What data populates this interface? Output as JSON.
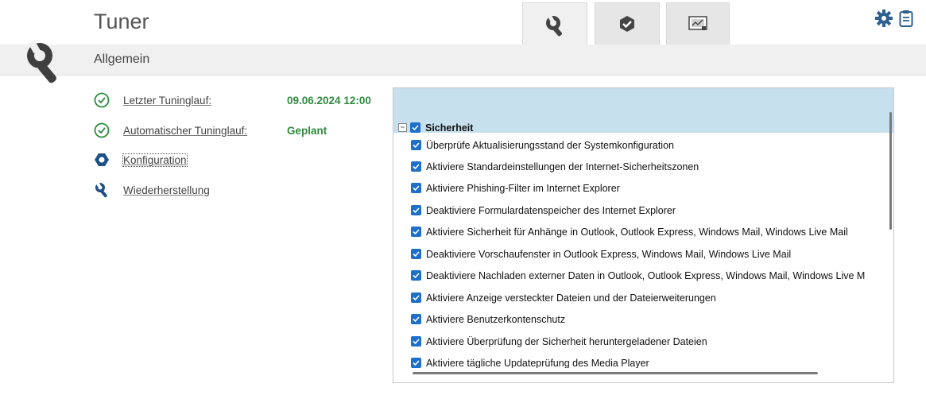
{
  "header": {
    "title": "Tuner",
    "tabs": [
      {
        "icon": "wrench-icon",
        "active": true
      },
      {
        "icon": "shield-check-icon",
        "active": false
      },
      {
        "icon": "screen-graph-icon",
        "active": false
      }
    ],
    "actions": [
      {
        "icon": "gear-icon"
      },
      {
        "icon": "clipboard-icon"
      }
    ]
  },
  "subheader": {
    "label": "Allgemein"
  },
  "sidebar": {
    "items": [
      {
        "label": "Letzter Tuninglauf:",
        "value": "09.06.2024 12:00",
        "icon": "check-circle-icon"
      },
      {
        "label": "Automatischer Tuninglauf:",
        "value": "Geplant",
        "icon": "check-circle-icon"
      },
      {
        "label": "Konfiguration",
        "icon": "hexagon-icon"
      },
      {
        "label": "Wiederherstellung",
        "icon": "wrench-icon"
      }
    ]
  },
  "tree": {
    "group": {
      "label": "Sicherheit",
      "expander": "−",
      "checked": true
    },
    "items": [
      {
        "label": "Überprüfe Aktualisierungsstand der Systemkonfiguration",
        "checked": true
      },
      {
        "label": "Aktiviere Standardeinstellungen der Internet-Sicherheitszonen",
        "checked": true
      },
      {
        "label": "Aktiviere Phishing-Filter im Internet Explorer",
        "checked": true
      },
      {
        "label": "Deaktiviere Formulardatenspeicher des Internet Explorer",
        "checked": true
      },
      {
        "label": "Aktiviere Sicherheit für Anhänge in Outlook, Outlook Express, Windows Mail, Windows Live Mail",
        "checked": true
      },
      {
        "label": "Deaktiviere Vorschaufenster in Outlook Express, Windows Mail, Windows Live Mail",
        "checked": true
      },
      {
        "label": "Deaktiviere Nachladen externer Daten in Outlook, Outlook Express, Windows Mail, Windows Live M",
        "checked": true
      },
      {
        "label": "Aktiviere Anzeige versteckter Dateien und der Dateierweiterungen",
        "checked": true
      },
      {
        "label": "Aktiviere Benutzerkontenschutz",
        "checked": true
      },
      {
        "label": "Aktiviere Überprüfung der Sicherheit heruntergeladener Dateien",
        "checked": true
      },
      {
        "label": "Aktiviere tägliche Updateprüfung des Media Player",
        "checked": true
      }
    ]
  },
  "colors": {
    "accent": "#1e6fc9",
    "status_green": "#2e8b3e",
    "selection": "#c7e0ee"
  }
}
